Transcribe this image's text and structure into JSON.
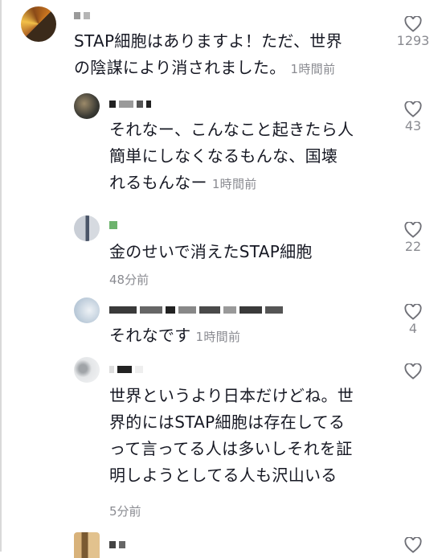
{
  "comments": [
    {
      "text": "STAP細胞はありますよ！ただ、世界\nの陰謀により消されました。",
      "time": "1時間前",
      "likes": "1293"
    },
    {
      "text": "それなー、こんなこと起きたら人\n簡単にしなくなるもんな、国壊\nれるもんなー",
      "time": "1時間前",
      "likes": "43"
    },
    {
      "text": "金のせいで消えたSTAP細胞",
      "time": "48分前",
      "likes": "22"
    },
    {
      "text": "それなです",
      "time": "1時間前",
      "likes": "4"
    },
    {
      "text": "世界というより日本だけどね。世\n界的にはSTAP細胞は存在してる\nって言ってる人は多いしそれを証\n明しようとしてる人も沢山いる",
      "time": "5分前",
      "likes": ""
    }
  ],
  "colors": {
    "text": "#161823",
    "muted": "#8a8b91",
    "background": "#ffffff"
  },
  "icons": {
    "like": "heart-outline-icon"
  }
}
